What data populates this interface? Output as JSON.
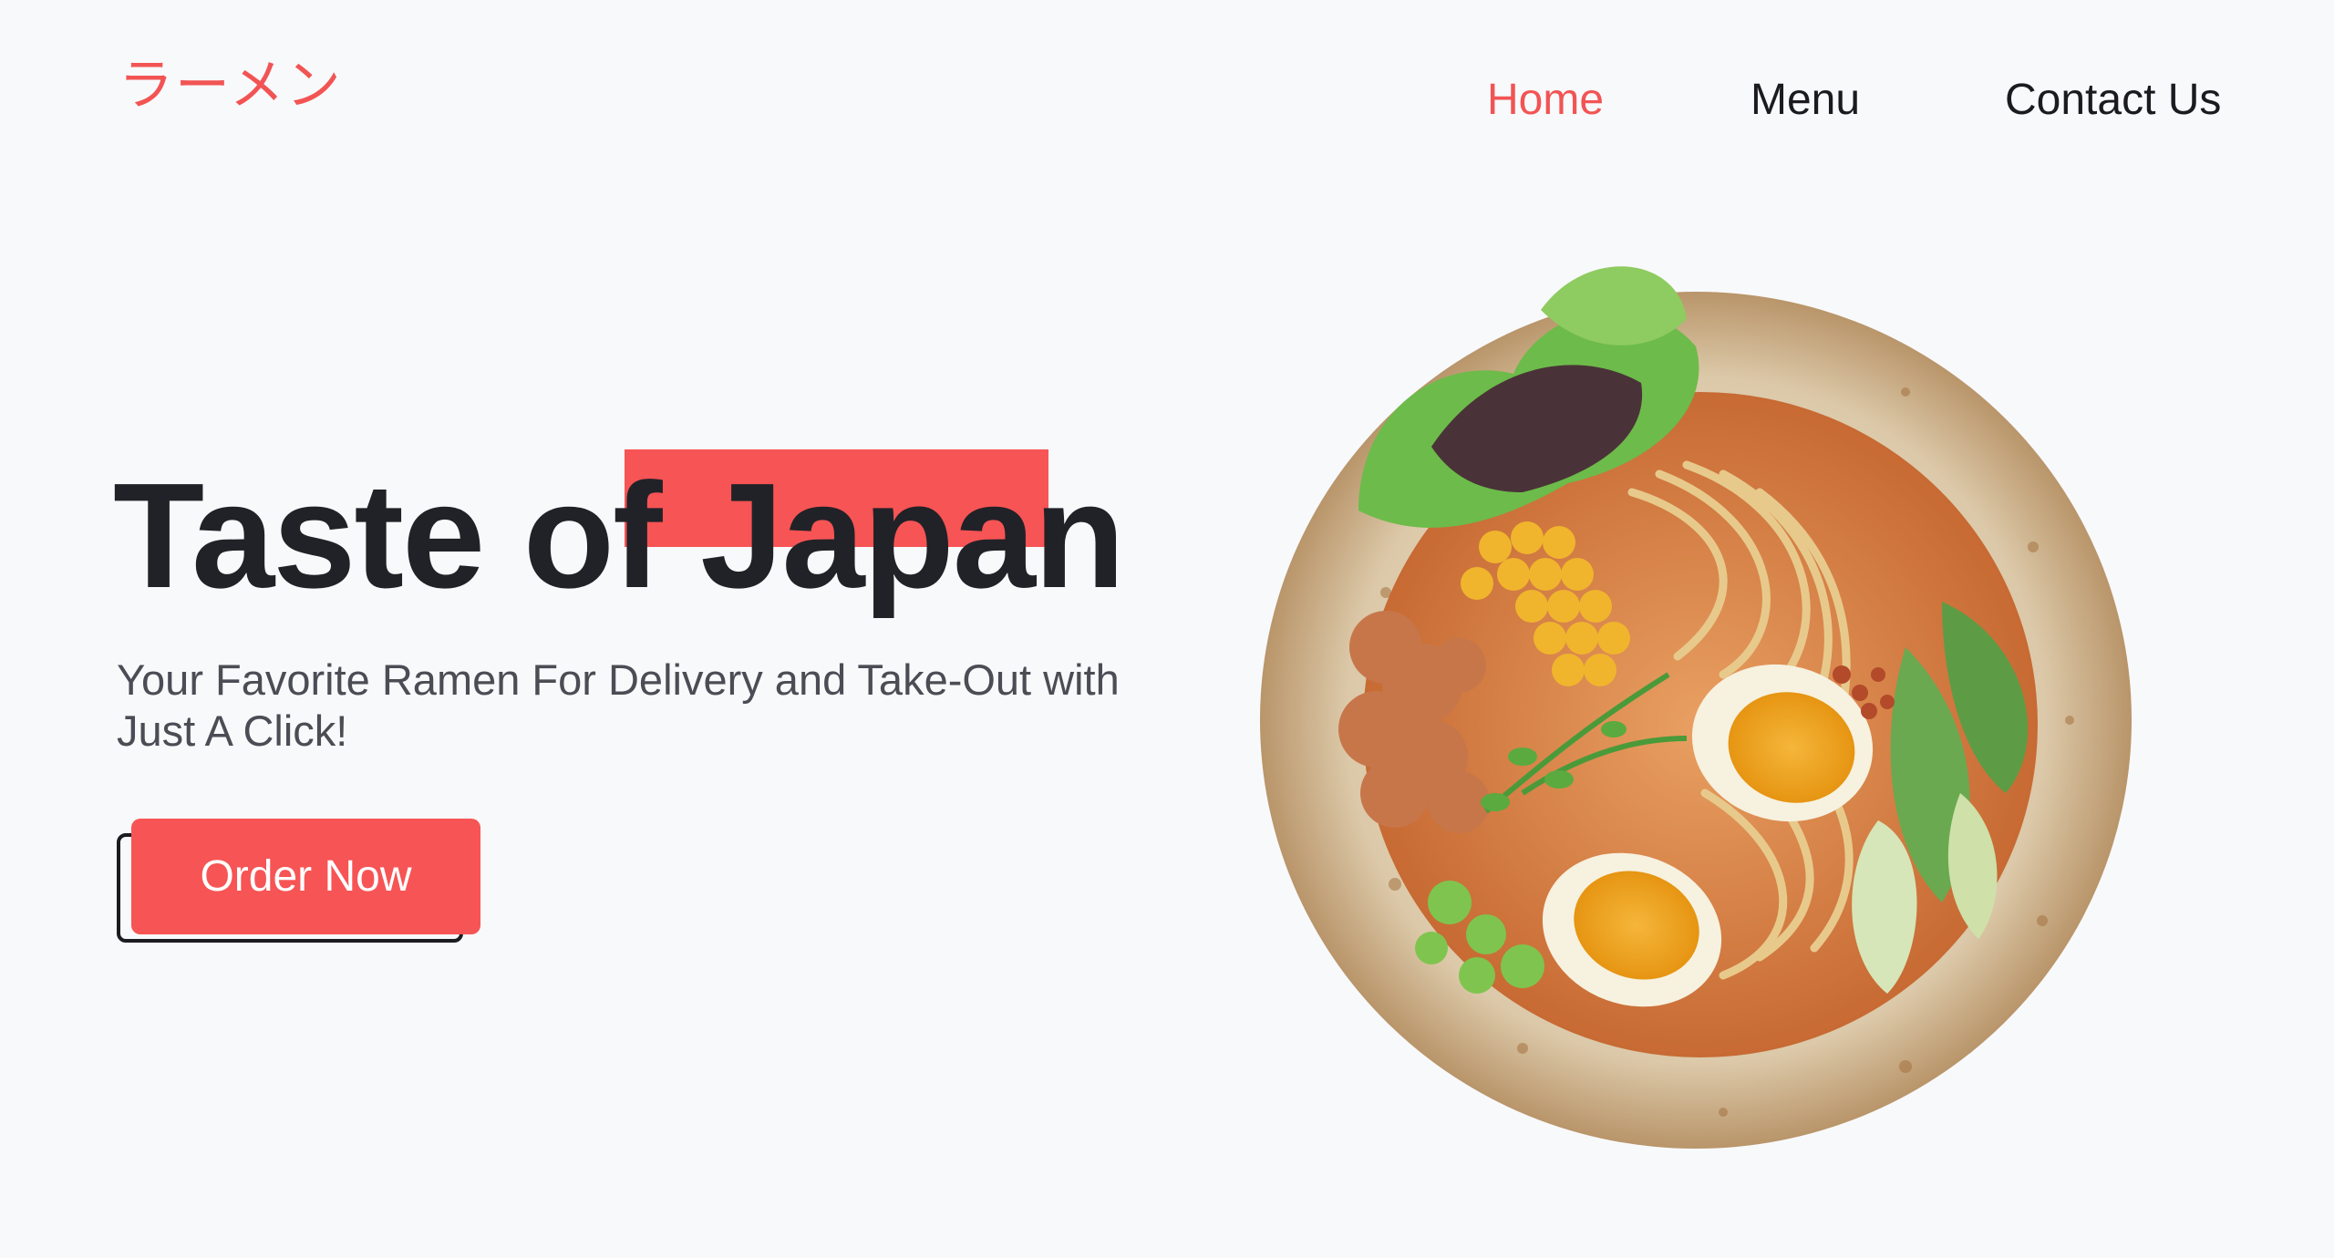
{
  "header": {
    "logo_text": "ラーメン",
    "nav": [
      {
        "label": "Home",
        "active": true
      },
      {
        "label": "Menu",
        "active": false
      },
      {
        "label": "Contact Us",
        "active": false
      }
    ]
  },
  "hero": {
    "headline": "Taste of Japan",
    "subtitle": "Your Favorite Ramen For Delivery and Take-Out with Just A Click!",
    "cta_label": "Order Now",
    "image_icon": "ramen-bowl-image"
  },
  "colors": {
    "accent": "#f75455",
    "text_dark": "#212227",
    "text_muted": "#4b4d55",
    "background": "#f8f9fb"
  }
}
